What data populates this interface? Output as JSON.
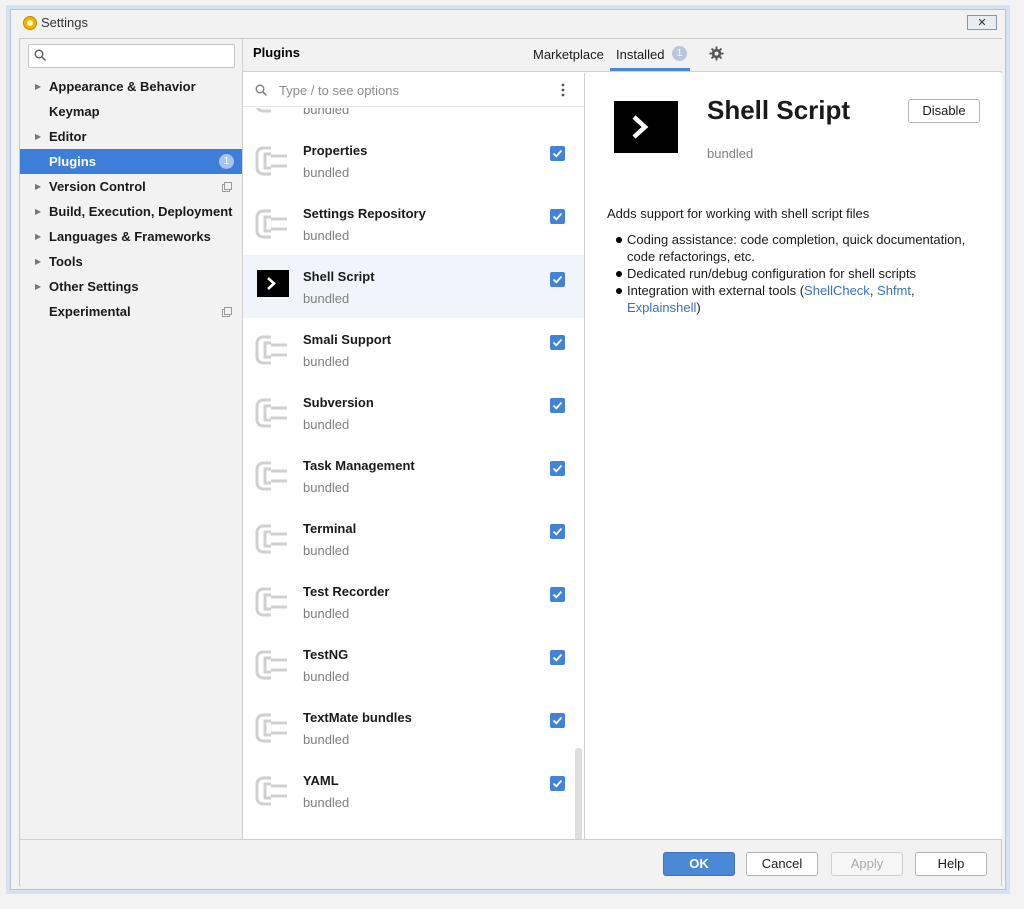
{
  "window": {
    "title": "Settings",
    "close_glyph": "✕"
  },
  "sidebar": {
    "search_placeholder": "",
    "items": [
      {
        "label": "Appearance & Behavior",
        "expandable": true
      },
      {
        "label": "Keymap",
        "expandable": false
      },
      {
        "label": "Editor",
        "expandable": true
      },
      {
        "label": "Plugins",
        "expandable": false,
        "selected": true,
        "badge": "1"
      },
      {
        "label": "Version Control",
        "expandable": true,
        "copy_icon": true
      },
      {
        "label": "Build, Execution, Deployment",
        "expandable": true
      },
      {
        "label": "Languages & Frameworks",
        "expandable": true
      },
      {
        "label": "Tools",
        "expandable": true
      },
      {
        "label": "Other Settings",
        "expandable": true
      },
      {
        "label": "Experimental",
        "expandable": false,
        "copy_icon": true
      }
    ]
  },
  "header": {
    "title": "Plugins",
    "tabs": [
      {
        "label": "Marketplace",
        "active": false
      },
      {
        "label": "Installed",
        "active": true,
        "badge": "1"
      }
    ]
  },
  "plugin_list": {
    "search_placeholder": "Type / to see options",
    "items": [
      {
        "name": "",
        "sub": "bundled",
        "checked": true
      },
      {
        "name": "Properties",
        "sub": "bundled",
        "checked": true
      },
      {
        "name": "Settings Repository",
        "sub": "bundled",
        "checked": true
      },
      {
        "name": "Shell Script",
        "sub": "bundled",
        "checked": true,
        "selected": true
      },
      {
        "name": "Smali Support",
        "sub": "bundled",
        "checked": true
      },
      {
        "name": "Subversion",
        "sub": "bundled",
        "checked": true
      },
      {
        "name": "Task Management",
        "sub": "bundled",
        "checked": true
      },
      {
        "name": "Terminal",
        "sub": "bundled",
        "checked": true
      },
      {
        "name": "Test Recorder",
        "sub": "bundled",
        "checked": true
      },
      {
        "name": "TestNG",
        "sub": "bundled",
        "checked": true
      },
      {
        "name": "TextMate bundles",
        "sub": "bundled",
        "checked": true
      },
      {
        "name": "YAML",
        "sub": "bundled",
        "checked": true
      }
    ]
  },
  "detail": {
    "name": "Shell Script",
    "sub": "bundled",
    "disable_label": "Disable",
    "description": "Adds support for working with shell script files",
    "bullets": {
      "b1": "Coding assistance: code completion, quick documentation, code refactorings, etc.",
      "b2": "Dedicated run/debug configuration for shell scripts",
      "b3_prefix": "Integration with external tools (",
      "link1": "ShellCheck",
      "sep1": ", ",
      "link2": "Shfmt",
      "sep2": ",",
      "link3": "Explainshell",
      "b3_suffix": ")"
    }
  },
  "footer": {
    "ok": "OK",
    "cancel": "Cancel",
    "apply": "Apply",
    "help": "Help"
  },
  "colors": {
    "accent": "#3c7ed8",
    "checkbox": "#4083d7",
    "link": "#3970c4"
  }
}
